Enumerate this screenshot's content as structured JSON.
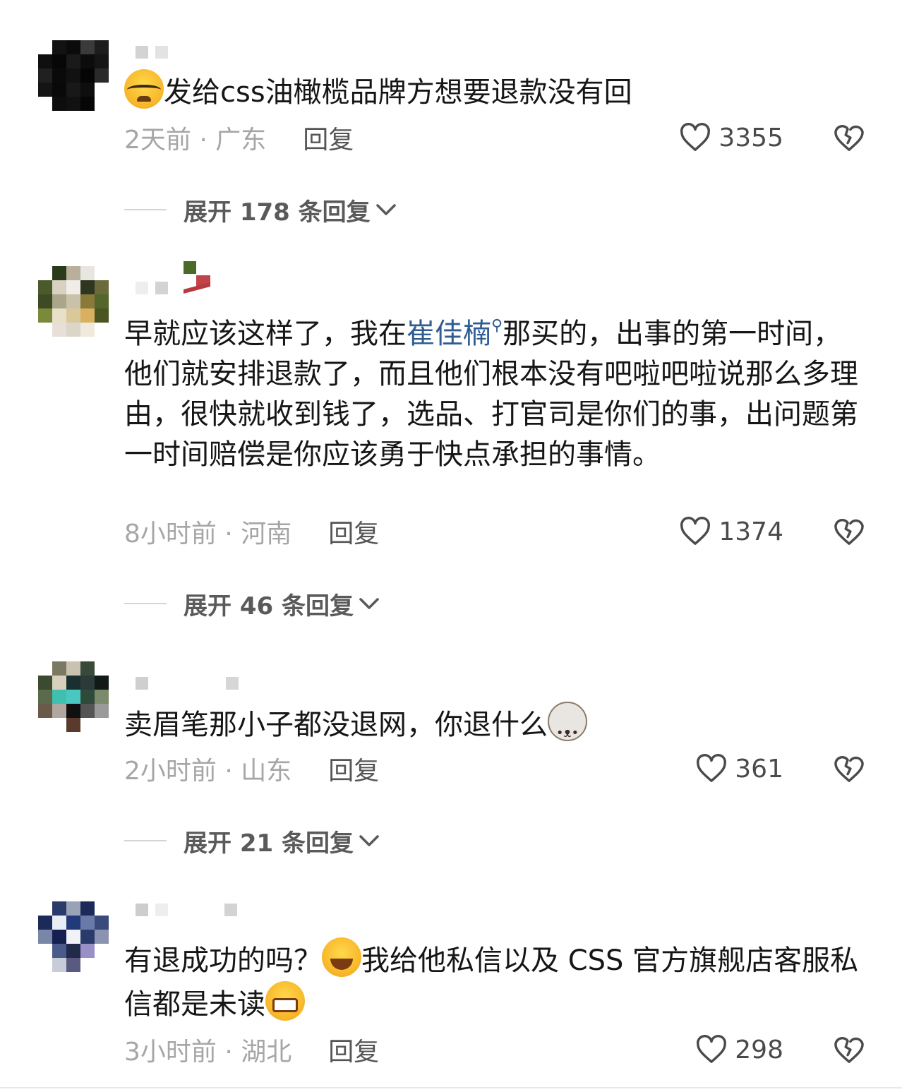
{
  "comments": [
    {
      "text": "发给css油橄榄品牌方想要退款没有回",
      "time_location": "2天前 · 广东",
      "reply_label": "回复",
      "likes": "3355",
      "expand_label": "展开 178 条回复"
    },
    {
      "text_pre": "早就应该这样了，我在",
      "mention": "崔佳楠",
      "text_post": "那买的，出事的第一时间，他们就安排退款了，而且他们根本没有吧啦吧啦说那么多理由，很快就收到钱了，选品、打官司是你们的事，出问题第一时间赔偿是你应该勇于快点承担的事情。",
      "time_location": "8小时前 · 河南",
      "reply_label": "回复",
      "likes": "1374",
      "expand_label": "展开 46 条回复"
    },
    {
      "text": "卖眉笔那小子都没退网，你退什么",
      "time_location": "2小时前 · 山东",
      "reply_label": "回复",
      "likes": "361",
      "expand_label": "展开 21 条回复"
    },
    {
      "text_pre": "有退成功的吗？",
      "text_mid": "我给他私信以及 CSS 官方旗舰店客服私信都是未读",
      "time_location": "3小时前 · 湖北",
      "reply_label": "回复",
      "likes": "298"
    }
  ],
  "icons": {
    "like": "heart-outline-icon",
    "dislike": "broken-heart-icon",
    "expand": "chevron-down-icon",
    "mention_search": "search-icon"
  },
  "colors": {
    "mention": "#2f5d93",
    "meta": "#a6a6a6",
    "text": "#161616"
  }
}
